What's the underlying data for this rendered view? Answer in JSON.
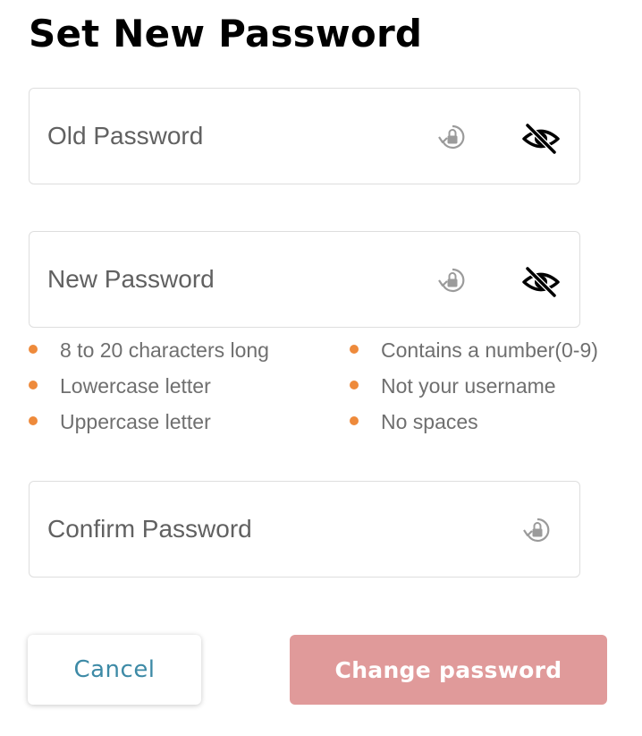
{
  "page": {
    "title": "Set New Password"
  },
  "fields": {
    "old_password": {
      "placeholder": "Old Password",
      "value": "",
      "icons": [
        "lock-refresh-icon",
        "eye-slash-icon"
      ]
    },
    "new_password": {
      "placeholder": "New Password",
      "value": "",
      "icons": [
        "lock-refresh-icon",
        "eye-slash-icon"
      ]
    },
    "confirm_password": {
      "placeholder": "Confirm Password",
      "value": "",
      "icons": [
        "lock-refresh-icon"
      ]
    }
  },
  "requirements": {
    "items": [
      {
        "label": "8 to 20 characters long"
      },
      {
        "label": "Lowercase letter"
      },
      {
        "label": "Uppercase letter"
      },
      {
        "label": "Contains a number(0-9)"
      },
      {
        "label": "Not your username"
      },
      {
        "label": "No spaces"
      }
    ],
    "bullet_color": "#ee8a3b"
  },
  "buttons": {
    "cancel_label": "Cancel",
    "change_label": "Change password"
  },
  "colors": {
    "cancel_text": "#3d8aa6",
    "change_background": "#e09a9a",
    "icon_gray": "#9b9b9b"
  }
}
